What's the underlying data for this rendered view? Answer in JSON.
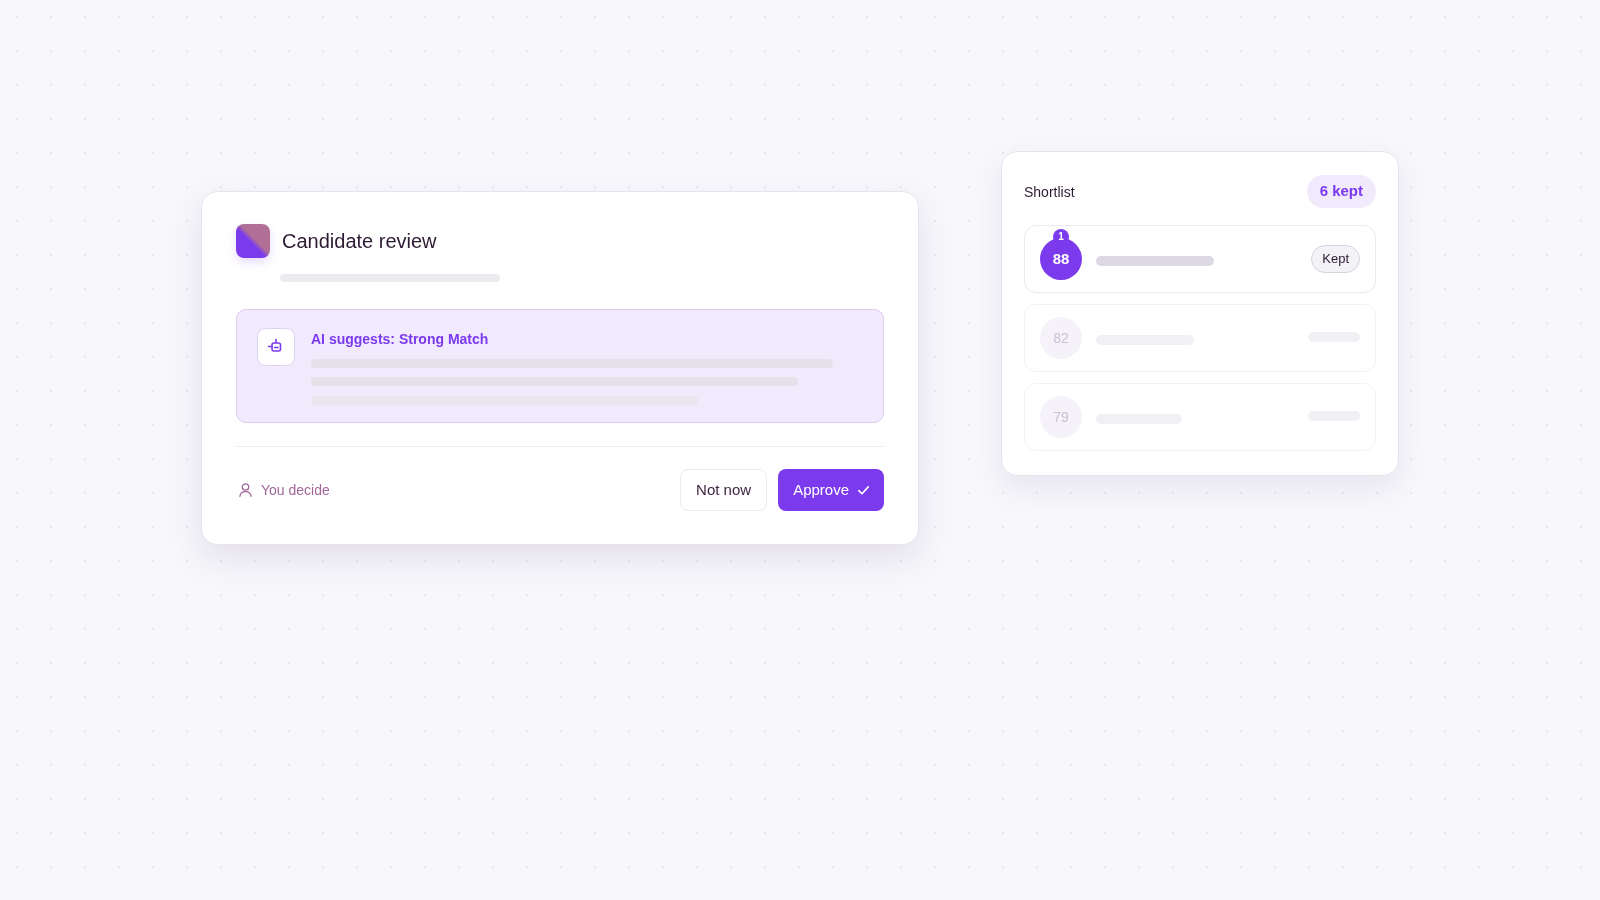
{
  "review_card": {
    "title": "Candidate review",
    "suggestion": {
      "label": "AI suggests: Strong Match"
    },
    "footer_note": "You decide",
    "buttons": [
      {
        "label": "Not now",
        "kind": "secondary"
      },
      {
        "label": "Approve",
        "kind": "primary"
      }
    ]
  },
  "shortlist": {
    "title": "Shortlist",
    "count": "6 kept",
    "candidates": [
      {
        "score": "88",
        "rank": "1",
        "status": "Kept",
        "selected": true
      },
      {
        "score": "82",
        "selected": false
      },
      {
        "score": "79",
        "selected": false
      }
    ]
  }
}
